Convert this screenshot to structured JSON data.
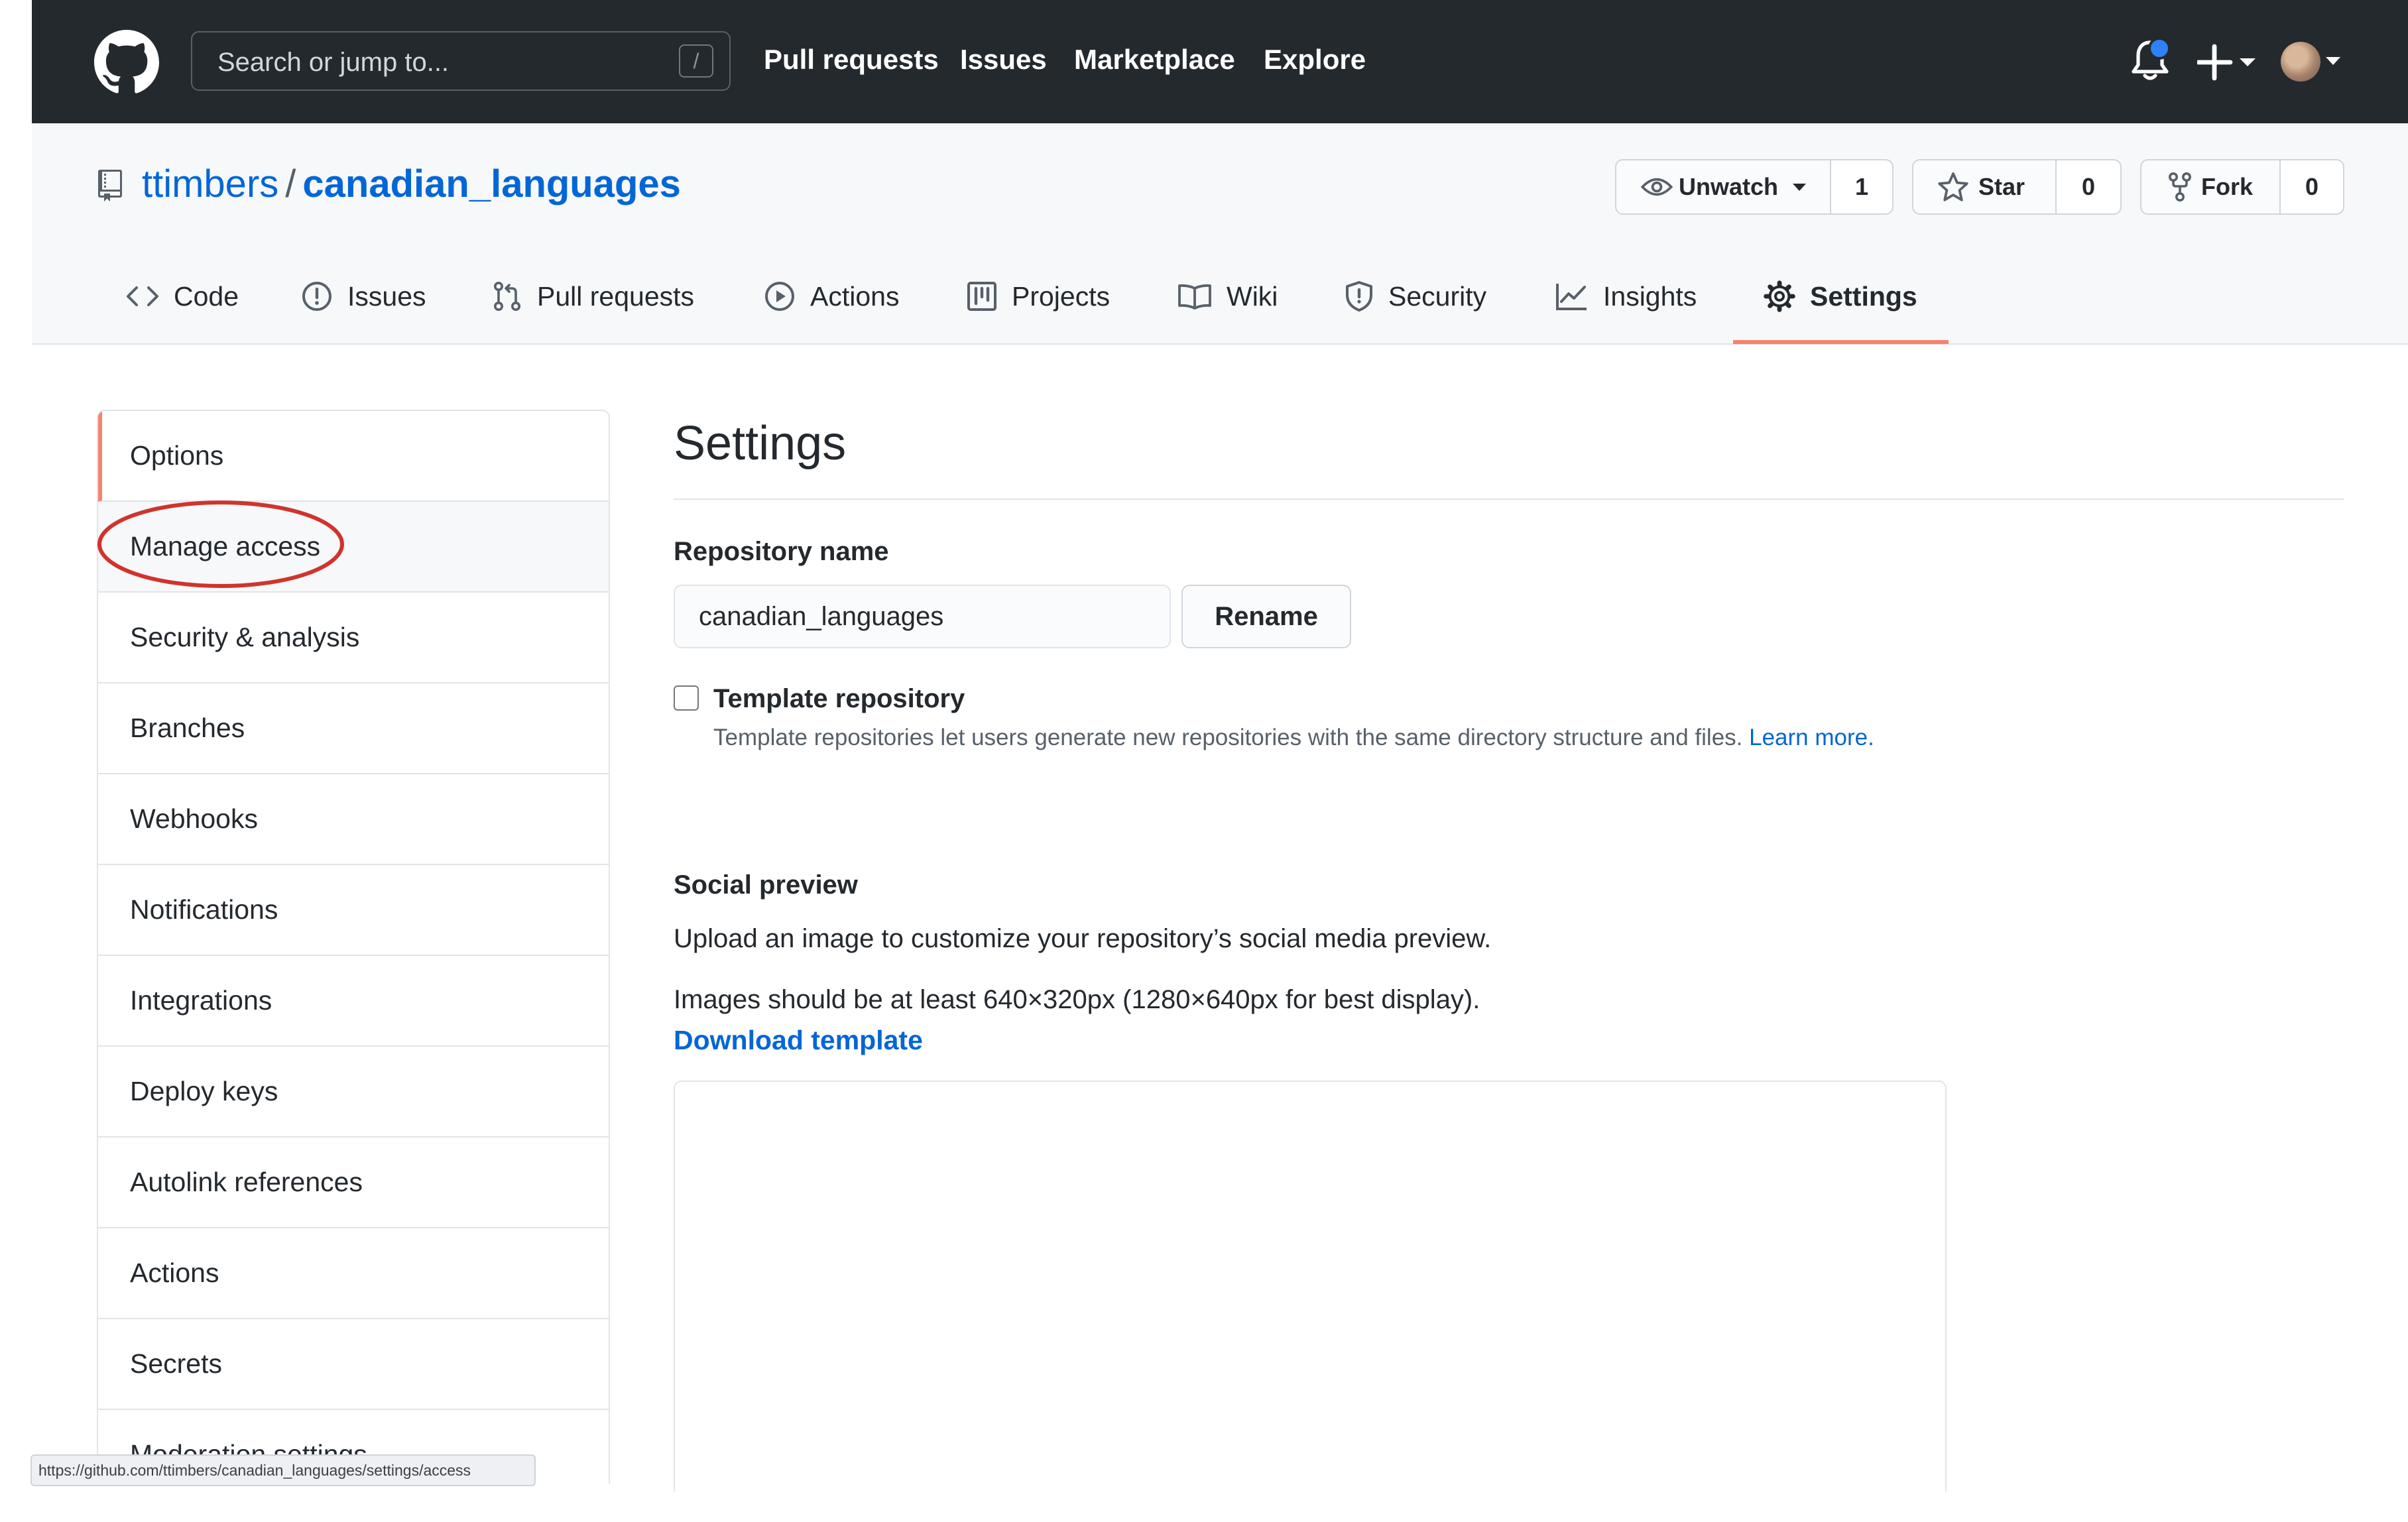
{
  "header": {
    "search_placeholder": "Search or jump to...",
    "search_shortcut": "/",
    "nav": [
      "Pull requests",
      "Issues",
      "Marketplace",
      "Explore"
    ],
    "notification_dot_color": "#2f81f7",
    "icons": [
      "github-logo-icon",
      "bell-icon",
      "plus-icon",
      "avatar"
    ]
  },
  "repo": {
    "owner": "ttimbers",
    "separator": "/",
    "name": "canadian_languages",
    "watch_label": "Unwatch",
    "watch_count": "1",
    "star_label": "Star",
    "star_count": "0",
    "fork_label": "Fork",
    "fork_count": "0"
  },
  "tabs": [
    {
      "label": "Code",
      "icon": "code-icon"
    },
    {
      "label": "Issues",
      "icon": "issue-icon"
    },
    {
      "label": "Pull requests",
      "icon": "pull-request-icon"
    },
    {
      "label": "Actions",
      "icon": "play-icon"
    },
    {
      "label": "Projects",
      "icon": "project-icon"
    },
    {
      "label": "Wiki",
      "icon": "book-icon"
    },
    {
      "label": "Security",
      "icon": "shield-icon"
    },
    {
      "label": "Insights",
      "icon": "graph-icon"
    },
    {
      "label": "Settings",
      "icon": "gear-icon",
      "selected": true
    }
  ],
  "sidebar": {
    "items": [
      {
        "label": "Options",
        "selected": true
      },
      {
        "label": "Manage access",
        "highlighted": true
      },
      {
        "label": "Security & analysis"
      },
      {
        "label": "Branches"
      },
      {
        "label": "Webhooks"
      },
      {
        "label": "Notifications"
      },
      {
        "label": "Integrations"
      },
      {
        "label": "Deploy keys"
      },
      {
        "label": "Autolink references"
      },
      {
        "label": "Actions"
      },
      {
        "label": "Secrets"
      },
      {
        "label": "Moderation settings"
      }
    ],
    "annotation_color": "#d0342c"
  },
  "status_url": "https://github.com/ttimbers/canadian_languages/settings/access",
  "main": {
    "title": "Settings",
    "repo_name_label": "Repository name",
    "repo_name_value": "canadian_languages",
    "rename_button": "Rename",
    "template_label": "Template repository",
    "template_note": "Template repositories let users generate new repositories with the same directory structure and files.",
    "learn_more": "Learn more",
    "social_preview_label": "Social preview",
    "social_preview_text": "Upload an image to customize your repository’s social media preview.",
    "image_size_text": "Images should be at least 640×320px (1280×640px for best display).",
    "download_template": "Download template"
  },
  "colors": {
    "header_bg": "#24292e",
    "link": "#0366d6",
    "selected_accent": "#f9826c"
  }
}
